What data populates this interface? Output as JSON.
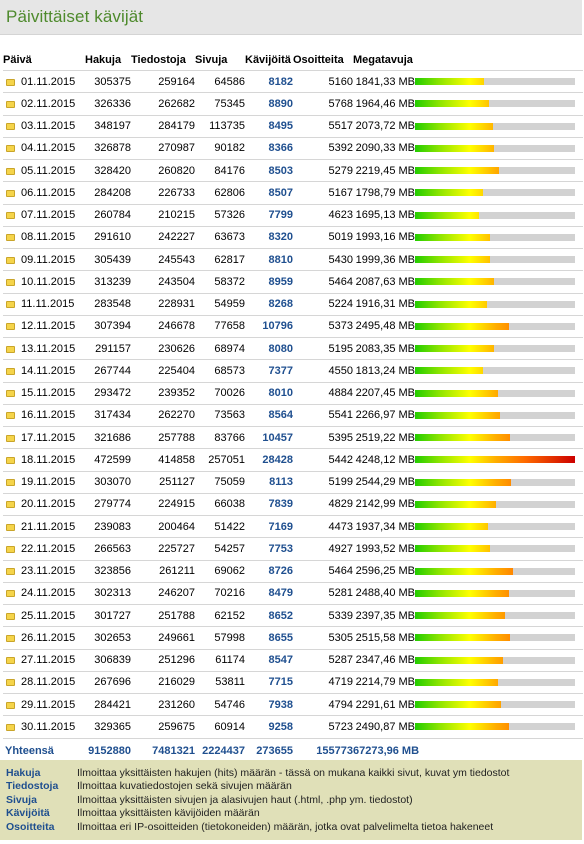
{
  "header": {
    "title": "Päivittäiset kävijät"
  },
  "columns": [
    "Päivä",
    "Hakuja",
    "Tiedostoja",
    "Sivuja",
    "Kävijöitä",
    "Osoitteita",
    "Megatavuja"
  ],
  "rows": [
    {
      "date": "01.11.2015",
      "hakuja": "305375",
      "tiedostoja": "259164",
      "sivuja": "64586",
      "kavijoita": "8182",
      "osoitteita": "5160",
      "megatavuja": "1841,33 MB",
      "mb": 1841.33
    },
    {
      "date": "02.11.2015",
      "hakuja": "326336",
      "tiedostoja": "262682",
      "sivuja": "75345",
      "kavijoita": "8890",
      "osoitteita": "5768",
      "megatavuja": "1964,46 MB",
      "mb": 1964.46
    },
    {
      "date": "03.11.2015",
      "hakuja": "348197",
      "tiedostoja": "284179",
      "sivuja": "113735",
      "kavijoita": "8495",
      "osoitteita": "5517",
      "megatavuja": "2073,72 MB",
      "mb": 2073.72
    },
    {
      "date": "04.11.2015",
      "hakuja": "326878",
      "tiedostoja": "270987",
      "sivuja": "90182",
      "kavijoita": "8366",
      "osoitteita": "5392",
      "megatavuja": "2090,33 MB",
      "mb": 2090.33
    },
    {
      "date": "05.11.2015",
      "hakuja": "328420",
      "tiedostoja": "260820",
      "sivuja": "84176",
      "kavijoita": "8503",
      "osoitteita": "5279",
      "megatavuja": "2219,45 MB",
      "mb": 2219.45
    },
    {
      "date": "06.11.2015",
      "hakuja": "284208",
      "tiedostoja": "226733",
      "sivuja": "62806",
      "kavijoita": "8507",
      "osoitteita": "5167",
      "megatavuja": "1798,79 MB",
      "mb": 1798.79
    },
    {
      "date": "07.11.2015",
      "hakuja": "260784",
      "tiedostoja": "210215",
      "sivuja": "57326",
      "kavijoita": "7799",
      "osoitteita": "4623",
      "megatavuja": "1695,13 MB",
      "mb": 1695.13
    },
    {
      "date": "08.11.2015",
      "hakuja": "291610",
      "tiedostoja": "242227",
      "sivuja": "63673",
      "kavijoita": "8320",
      "osoitteita": "5019",
      "megatavuja": "1993,16 MB",
      "mb": 1993.16
    },
    {
      "date": "09.11.2015",
      "hakuja": "305439",
      "tiedostoja": "245543",
      "sivuja": "62817",
      "kavijoita": "8810",
      "osoitteita": "5430",
      "megatavuja": "1999,36 MB",
      "mb": 1999.36
    },
    {
      "date": "10.11.2015",
      "hakuja": "313239",
      "tiedostoja": "243504",
      "sivuja": "58372",
      "kavijoita": "8959",
      "osoitteita": "5464",
      "megatavuja": "2087,63 MB",
      "mb": 2087.63
    },
    {
      "date": "11.11.2015",
      "hakuja": "283548",
      "tiedostoja": "228931",
      "sivuja": "54959",
      "kavijoita": "8268",
      "osoitteita": "5224",
      "megatavuja": "1916,31 MB",
      "mb": 1916.31
    },
    {
      "date": "12.11.2015",
      "hakuja": "307394",
      "tiedostoja": "246678",
      "sivuja": "77658",
      "kavijoita": "10796",
      "osoitteita": "5373",
      "megatavuja": "2495,48 MB",
      "mb": 2495.48
    },
    {
      "date": "13.11.2015",
      "hakuja": "291157",
      "tiedostoja": "230626",
      "sivuja": "68974",
      "kavijoita": "8080",
      "osoitteita": "5195",
      "megatavuja": "2083,35 MB",
      "mb": 2083.35
    },
    {
      "date": "14.11.2015",
      "hakuja": "267744",
      "tiedostoja": "225404",
      "sivuja": "68573",
      "kavijoita": "7377",
      "osoitteita": "4550",
      "megatavuja": "1813,24 MB",
      "mb": 1813.24
    },
    {
      "date": "15.11.2015",
      "hakuja": "293472",
      "tiedostoja": "239352",
      "sivuja": "70026",
      "kavijoita": "8010",
      "osoitteita": "4884",
      "megatavuja": "2207,45 MB",
      "mb": 2207.45
    },
    {
      "date": "16.11.2015",
      "hakuja": "317434",
      "tiedostoja": "262270",
      "sivuja": "73563",
      "kavijoita": "8564",
      "osoitteita": "5541",
      "megatavuja": "2266,97 MB",
      "mb": 2266.97
    },
    {
      "date": "17.11.2015",
      "hakuja": "321686",
      "tiedostoja": "257788",
      "sivuja": "83766",
      "kavijoita": "10457",
      "osoitteita": "5395",
      "megatavuja": "2519,22 MB",
      "mb": 2519.22
    },
    {
      "date": "18.11.2015",
      "hakuja": "472599",
      "tiedostoja": "414858",
      "sivuja": "257051",
      "kavijoita": "28428",
      "osoitteita": "5442",
      "megatavuja": "4248,12 MB",
      "mb": 4248.12
    },
    {
      "date": "19.11.2015",
      "hakuja": "303070",
      "tiedostoja": "251127",
      "sivuja": "75059",
      "kavijoita": "8113",
      "osoitteita": "5199",
      "megatavuja": "2544,29 MB",
      "mb": 2544.29
    },
    {
      "date": "20.11.2015",
      "hakuja": "279774",
      "tiedostoja": "224915",
      "sivuja": "66038",
      "kavijoita": "7839",
      "osoitteita": "4829",
      "megatavuja": "2142,99 MB",
      "mb": 2142.99
    },
    {
      "date": "21.11.2015",
      "hakuja": "239083",
      "tiedostoja": "200464",
      "sivuja": "51422",
      "kavijoita": "7169",
      "osoitteita": "4473",
      "megatavuja": "1937,34 MB",
      "mb": 1937.34
    },
    {
      "date": "22.11.2015",
      "hakuja": "266563",
      "tiedostoja": "225727",
      "sivuja": "54257",
      "kavijoita": "7753",
      "osoitteita": "4927",
      "megatavuja": "1993,52 MB",
      "mb": 1993.52
    },
    {
      "date": "23.11.2015",
      "hakuja": "323856",
      "tiedostoja": "261211",
      "sivuja": "69062",
      "kavijoita": "8726",
      "osoitteita": "5464",
      "megatavuja": "2596,25 MB",
      "mb": 2596.25
    },
    {
      "date": "24.11.2015",
      "hakuja": "302313",
      "tiedostoja": "246207",
      "sivuja": "70216",
      "kavijoita": "8479",
      "osoitteita": "5281",
      "megatavuja": "2488,40 MB",
      "mb": 2488.4
    },
    {
      "date": "25.11.2015",
      "hakuja": "301727",
      "tiedostoja": "251788",
      "sivuja": "62152",
      "kavijoita": "8652",
      "osoitteita": "5339",
      "megatavuja": "2397,35 MB",
      "mb": 2397.35
    },
    {
      "date": "26.11.2015",
      "hakuja": "302653",
      "tiedostoja": "249661",
      "sivuja": "57998",
      "kavijoita": "8655",
      "osoitteita": "5305",
      "megatavuja": "2515,58 MB",
      "mb": 2515.58
    },
    {
      "date": "27.11.2015",
      "hakuja": "306839",
      "tiedostoja": "251296",
      "sivuja": "61174",
      "kavijoita": "8547",
      "osoitteita": "5287",
      "megatavuja": "2347,46 MB",
      "mb": 2347.46
    },
    {
      "date": "28.11.2015",
      "hakuja": "267696",
      "tiedostoja": "216029",
      "sivuja": "53811",
      "kavijoita": "7715",
      "osoitteita": "4719",
      "megatavuja": "2214,79 MB",
      "mb": 2214.79
    },
    {
      "date": "29.11.2015",
      "hakuja": "284421",
      "tiedostoja": "231260",
      "sivuja": "54746",
      "kavijoita": "7938",
      "osoitteita": "4794",
      "megatavuja": "2291,61 MB",
      "mb": 2291.61
    },
    {
      "date": "30.11.2015",
      "hakuja": "329365",
      "tiedostoja": "259675",
      "sivuja": "60914",
      "kavijoita": "9258",
      "osoitteita": "5723",
      "megatavuja": "2490,87 MB",
      "mb": 2490.87
    }
  ],
  "bar_max_mb": 4248.12,
  "totals": {
    "label": "Yhteensä",
    "hakuja": "9152880",
    "tiedostoja": "7481321",
    "sivuja": "2224437",
    "kavijoita": "273655",
    "osoitteita": "155773",
    "megatavuja": "67273,96 MB"
  },
  "legend": [
    {
      "term": "Hakuja",
      "desc": "Ilmoittaa yksittäisten hakujen (hits) määrän - tässä on mukana kaikki sivut, kuvat ym tiedostot"
    },
    {
      "term": "Tiedostoja",
      "desc": "Ilmoittaa kuvatiedostojen sekä sivujen määrän"
    },
    {
      "term": "Sivuja",
      "desc": "Ilmoittaa yksittäisten sivujen ja alasivujen haut (.html, .php ym. tiedostot)"
    },
    {
      "term": "Kävijöitä",
      "desc": "Ilmoittaa yksittäisten kävijöiden määrän"
    },
    {
      "term": "Osoitteita",
      "desc": "Ilmoittaa eri IP-osoitteiden (tietokoneiden) määrän, jotka ovat palvelimelta tietoa hakeneet"
    }
  ],
  "colors": {
    "title": "#4e8a2c",
    "link": "#1f4f8f",
    "legend_bg": "#e0e0b8",
    "header_bg": "#e6e6e6"
  },
  "icons": {
    "row_icon": "folder-icon"
  }
}
